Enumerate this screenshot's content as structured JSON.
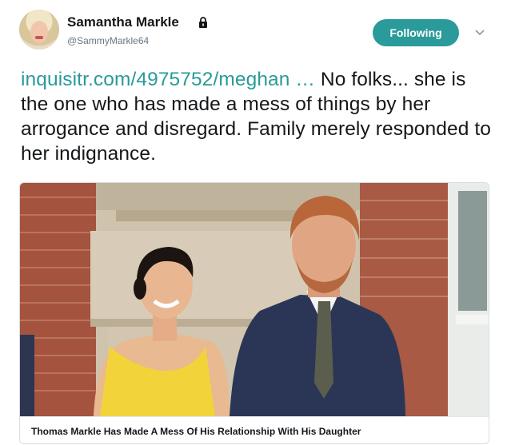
{
  "header": {
    "name": "Samantha Markle",
    "handle": "@SammyMarkle64",
    "follow_label": "Following"
  },
  "tweet": {
    "link_text": "inquisitr.com/4975752/meghan …",
    "body": " No folks... she is the one who has made a mess of things by her arrogance and disregard. Family merely responded to her indignance."
  },
  "card": {
    "caption": "Thomas Markle Has Made A Mess Of His Relationship With His Daughter"
  },
  "colors": {
    "accent": "#2a9a9a",
    "text": "#14171a",
    "muted": "#657786",
    "dress": "#f2d33a",
    "suit": "#2b3657"
  },
  "icons": [
    "lock-icon",
    "chevron-down-icon"
  ]
}
